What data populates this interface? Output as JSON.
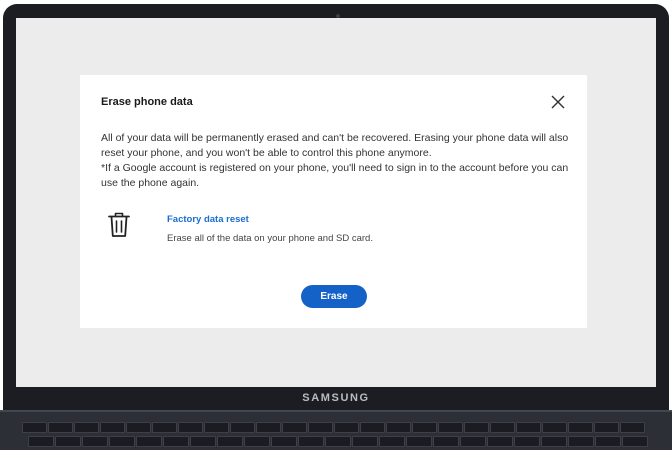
{
  "device": {
    "brand": "SAMSUNG"
  },
  "dialog": {
    "title": "Erase phone data",
    "close_icon": "close-icon",
    "body_line1": "All of your data will be permanently erased and can't be recovered. Erasing your phone data will also reset your phone, and you won't be able to control this phone anymore.",
    "body_line2": "*If a Google account is registered on your phone, you'll need to sign in to the account before you can use the phone again.",
    "option": {
      "icon": "trash-icon",
      "title": "Factory data reset",
      "description": "Erase all of the data on your phone and SD card."
    },
    "erase_button": "Erase"
  },
  "colors": {
    "accent": "#1462c8",
    "link": "#1a6fd1",
    "screen_bg": "#ececec",
    "bezel": "#1b1d22"
  }
}
